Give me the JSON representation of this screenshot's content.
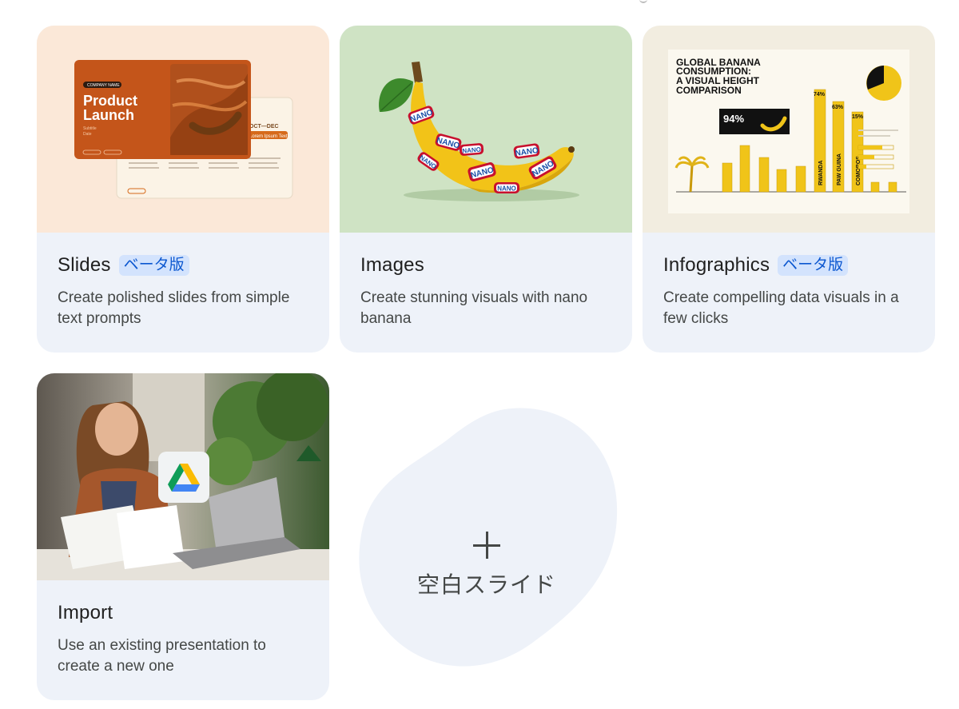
{
  "cards": {
    "slides": {
      "title": "Slides",
      "badge": "ベータ版",
      "description": "Create polished slides from simple text prompts",
      "thumb": {
        "company": "COMPANY NAME",
        "headline_1": "Product",
        "headline_2": "Launch",
        "subtitle": "Subtitle",
        "date": "Date",
        "back_label": "OCT—DEC",
        "back_tag": "Lorem Ipsum Text"
      }
    },
    "images": {
      "title": "Images",
      "description": "Create stunning visuals with nano banana",
      "thumb": {
        "sticker": "NANO"
      }
    },
    "infographics": {
      "title": "Infographics",
      "badge": "ベータ版",
      "description": "Create compelling data visuals in a few clicks",
      "thumb": {
        "headline_1": "GLOBAL BANANA",
        "headline_2": "CONSUMPTION:",
        "headline_3": "A VISUAL HEIGHT",
        "headline_4": "COMPARISON",
        "stat": "94%",
        "pct_74": "74%",
        "pct_63": "63%",
        "pct_15": "15%",
        "bar_rwanda": "RWANDA",
        "bar_png": "PAW GUINA",
        "bar_comoros": "COMOROS"
      }
    },
    "import": {
      "title": "Import",
      "description": "Use an existing presentation to create a new one"
    }
  },
  "blank_slide": {
    "label": "空白スライド"
  },
  "colors": {
    "card_bg": "#eef2f9",
    "badge_bg": "#d3e3fd",
    "badge_text": "#0b57d0",
    "blank_bg": "#eef2f9"
  }
}
